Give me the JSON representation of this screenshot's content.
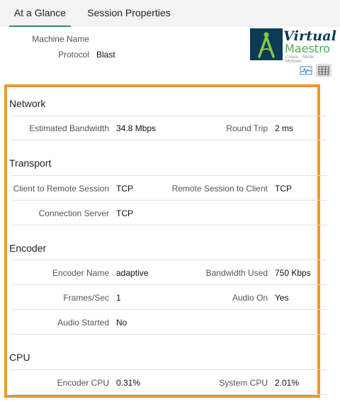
{
  "tabs": [
    {
      "label": "At a Glance",
      "active": true
    },
    {
      "label": "Session Properties",
      "active": false
    }
  ],
  "header": {
    "machine_name_label": "Machine Name",
    "machine_name_value": "",
    "protocol_label": "Protocol",
    "protocol_value": "Blast"
  },
  "logo": {
    "line1": "Virtual",
    "line2": "Maestro",
    "tagline": "Create · Recite · Motivate"
  },
  "view_toggle": [
    "chart-view-icon",
    "grid-view-icon"
  ],
  "accent_color": "#f0962a",
  "tab_underline_color": "#2e8b57",
  "sections": {
    "network": {
      "title": "Network",
      "est_bandwidth_label": "Estimated Bandwidth",
      "est_bandwidth_value": "34.8 Mbps",
      "round_trip_label": "Round Trip",
      "round_trip_value": "2 ms"
    },
    "transport": {
      "title": "Transport",
      "c2r_label": "Client to Remote Session",
      "c2r_value": "TCP",
      "r2c_label": "Remote Session to Client",
      "r2c_value": "TCP",
      "conn_server_label": "Connection Server",
      "conn_server_value": "TCP"
    },
    "encoder": {
      "title": "Encoder",
      "encoder_name_label": "Encoder Name",
      "encoder_name_value": "adaptive",
      "bandwidth_used_label": "Bandwidth Used",
      "bandwidth_used_value": "750 Kbps",
      "frames_label": "Frames/Sec",
      "frames_value": "1",
      "audio_on_label": "Audio On",
      "audio_on_value": "Yes",
      "audio_started_label": "Audio Started",
      "audio_started_value": "No"
    },
    "cpu": {
      "title": "CPU",
      "encoder_cpu_label": "Encoder CPU",
      "encoder_cpu_value": "0.31%",
      "system_cpu_label": "System CPU",
      "system_cpu_value": "2.01%"
    }
  }
}
